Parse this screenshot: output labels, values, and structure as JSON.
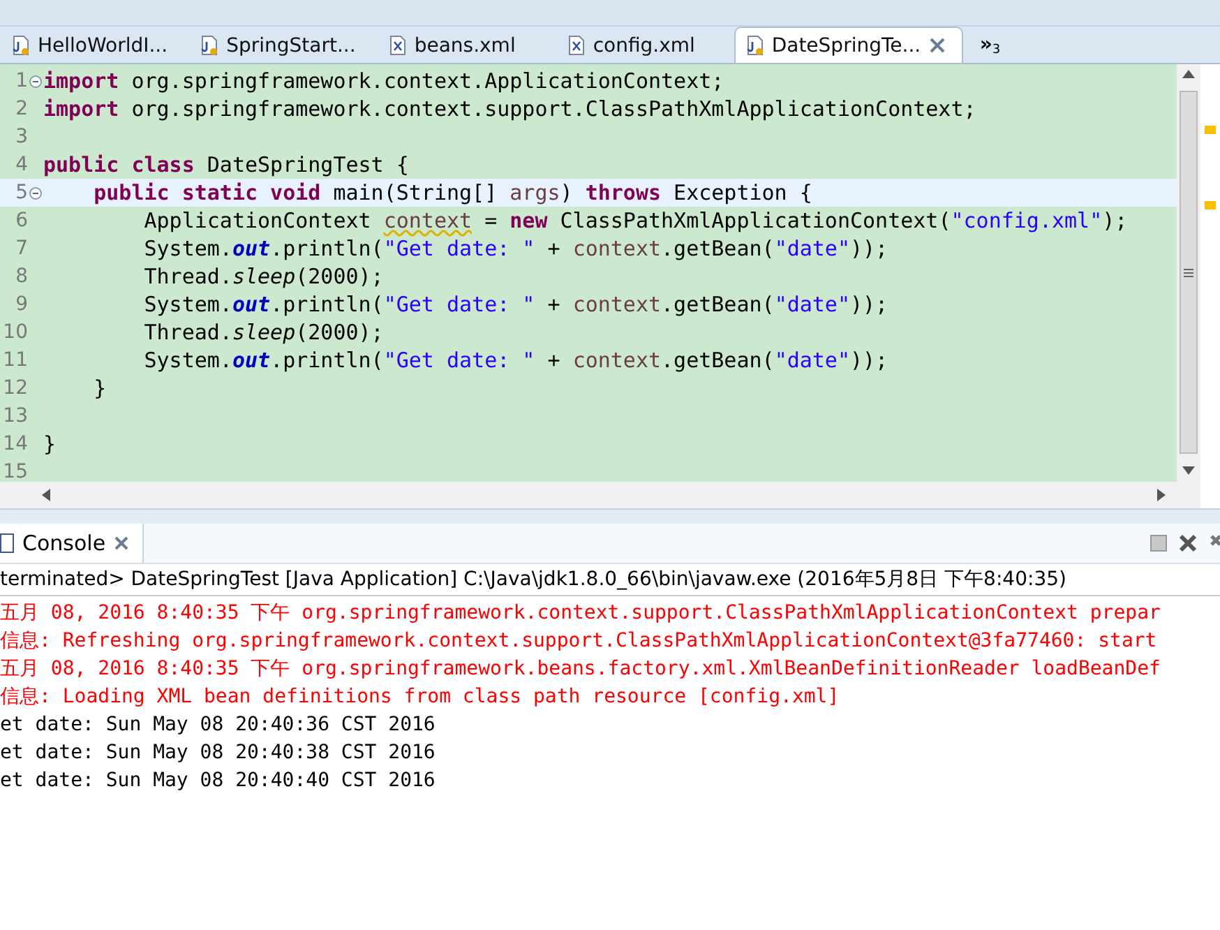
{
  "editor_tabs": [
    {
      "label": "HelloWorldI...",
      "kind": "java",
      "selected": false
    },
    {
      "label": "SpringStart...",
      "kind": "java",
      "selected": false
    },
    {
      "label": "beans.xml",
      "kind": "xml",
      "selected": false
    },
    {
      "label": "config.xml",
      "kind": "xml",
      "selected": false
    },
    {
      "label": "DateSpringTe...",
      "kind": "java",
      "selected": true
    }
  ],
  "tab_overflow": {
    "symbol": "»",
    "count": "3"
  },
  "editor": {
    "lines": [
      {
        "number": "1",
        "foldable": true,
        "current": false,
        "tokens": [
          {
            "kind": "keyword",
            "text": "import"
          },
          {
            "kind": "plain",
            "text": " org.springframework.context.ApplicationContext;"
          }
        ]
      },
      {
        "number": "2",
        "foldable": false,
        "current": false,
        "tokens": [
          {
            "kind": "keyword",
            "text": "import"
          },
          {
            "kind": "plain",
            "text": " org.springframework.context.support.ClassPathXmlApplicationContext;"
          }
        ]
      },
      {
        "number": "3",
        "foldable": false,
        "current": false
      },
      {
        "number": "4",
        "foldable": false,
        "current": false,
        "tokens": [
          {
            "kind": "keyword",
            "text": "public class"
          },
          {
            "kind": "plain",
            "text": " DateSpringTest {"
          }
        ]
      },
      {
        "number": "5",
        "foldable": true,
        "current": true,
        "tokens": [
          {
            "kind": "keyword",
            "text": "    public static void"
          },
          {
            "kind": "plain",
            "text": " main(String[] "
          },
          {
            "kind": "variable",
            "text": "args"
          },
          {
            "kind": "plain",
            "text": ") "
          },
          {
            "kind": "keyword",
            "text": "throws"
          },
          {
            "kind": "plain",
            "text": " Exception {"
          }
        ]
      },
      {
        "number": "6",
        "foldable": false,
        "current": false,
        "tokens": [
          {
            "kind": "plain",
            "text": "        ApplicationContext "
          },
          {
            "kind": "warning",
            "text": "context"
          },
          {
            "kind": "plain",
            "text": " = "
          },
          {
            "kind": "keyword",
            "text": "new"
          },
          {
            "kind": "plain",
            "text": " ClassPathXmlApplicationContext("
          },
          {
            "kind": "string",
            "text": "\"config.xml\""
          },
          {
            "kind": "plain",
            "text": ");"
          }
        ]
      },
      {
        "number": "7",
        "foldable": false,
        "current": false,
        "tokens": [
          {
            "kind": "plain",
            "text": "        System."
          },
          {
            "kind": "field",
            "text": "out"
          },
          {
            "kind": "plain",
            "text": ".println("
          },
          {
            "kind": "string",
            "text": "\"Get date: \""
          },
          {
            "kind": "plain",
            "text": " + "
          },
          {
            "kind": "variable",
            "text": "context"
          },
          {
            "kind": "plain",
            "text": ".getBean("
          },
          {
            "kind": "string",
            "text": "\"date\""
          },
          {
            "kind": "plain",
            "text": "));"
          }
        ]
      },
      {
        "number": "8",
        "foldable": false,
        "current": false,
        "tokens": [
          {
            "kind": "plain",
            "text": "        Thread."
          },
          {
            "kind": "static",
            "text": "sleep"
          },
          {
            "kind": "plain",
            "text": "(2000);"
          }
        ]
      },
      {
        "number": "9",
        "foldable": false,
        "current": false,
        "tokens": [
          {
            "kind": "plain",
            "text": "        System."
          },
          {
            "kind": "field",
            "text": "out"
          },
          {
            "kind": "plain",
            "text": ".println("
          },
          {
            "kind": "string",
            "text": "\"Get date: \""
          },
          {
            "kind": "plain",
            "text": " + "
          },
          {
            "kind": "variable",
            "text": "context"
          },
          {
            "kind": "plain",
            "text": ".getBean("
          },
          {
            "kind": "string",
            "text": "\"date\""
          },
          {
            "kind": "plain",
            "text": "));"
          }
        ]
      },
      {
        "number": "10",
        "foldable": false,
        "current": false,
        "tokens": [
          {
            "kind": "plain",
            "text": "        Thread."
          },
          {
            "kind": "static",
            "text": "sleep"
          },
          {
            "kind": "plain",
            "text": "(2000);"
          }
        ]
      },
      {
        "number": "11",
        "foldable": false,
        "current": false,
        "tokens": [
          {
            "kind": "plain",
            "text": "        System."
          },
          {
            "kind": "field",
            "text": "out"
          },
          {
            "kind": "plain",
            "text": ".println("
          },
          {
            "kind": "string",
            "text": "\"Get date: \""
          },
          {
            "kind": "plain",
            "text": " + "
          },
          {
            "kind": "variable",
            "text": "context"
          },
          {
            "kind": "plain",
            "text": ".getBean("
          },
          {
            "kind": "string",
            "text": "\"date\""
          },
          {
            "kind": "plain",
            "text": "));"
          }
        ]
      },
      {
        "number": "12",
        "foldable": false,
        "current": false,
        "tokens": [
          {
            "kind": "plain",
            "text": "    }"
          }
        ]
      },
      {
        "number": "13",
        "foldable": false,
        "current": false
      },
      {
        "number": "14",
        "foldable": false,
        "current": false,
        "tokens": [
          {
            "kind": "plain",
            "text": "}"
          }
        ]
      },
      {
        "number": "15",
        "foldable": false,
        "current": false
      }
    ]
  },
  "console": {
    "title": "Console",
    "process": "terminated> DateSpringTest [Java Application] C:\\Java\\jdk1.8.0_66\\bin\\javaw.exe (2016年5月8日 下午8:40:35)",
    "lines": [
      {
        "kind": "error",
        "text": "五月 08, 2016 8:40:35 下午 org.springframework.context.support.ClassPathXmlApplicationContext prepar"
      },
      {
        "kind": "error",
        "text": "信息: Refreshing org.springframework.context.support.ClassPathXmlApplicationContext@3fa77460: start"
      },
      {
        "kind": "error",
        "text": "五月 08, 2016 8:40:35 下午 org.springframework.beans.factory.xml.XmlBeanDefinitionReader loadBeanDef"
      },
      {
        "kind": "error",
        "text": "信息: Loading XML bean definitions from class path resource [config.xml]"
      },
      {
        "kind": "output",
        "text": "et date: Sun May 08 20:40:36 CST 2016"
      },
      {
        "kind": "output",
        "text": "et date: Sun May 08 20:40:38 CST 2016"
      },
      {
        "kind": "output",
        "text": "et date: Sun May 08 20:40:40 CST 2016"
      }
    ]
  }
}
